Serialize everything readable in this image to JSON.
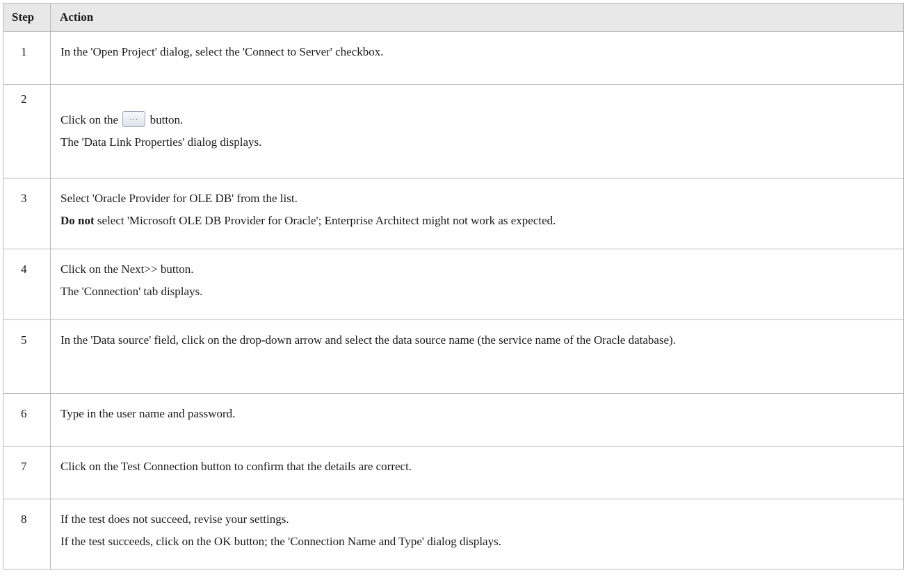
{
  "headers": {
    "step": "Step",
    "action": "Action"
  },
  "rows": [
    {
      "step": "1",
      "lines": [
        "In the 'Open Project' dialog, select the 'Connect to Server' checkbox."
      ]
    },
    {
      "step": "2",
      "click_before": "Click on the",
      "button_icon": "ellipsis-button-icon",
      "button_glyph": "···",
      "click_after": "button.",
      "line2": "The 'Data Link Properties' dialog displays."
    },
    {
      "step": "3",
      "line1": "Select 'Oracle Provider for OLE DB' from the list.",
      "bold": "Do not",
      "line2_rest": " select 'Microsoft OLE DB Provider for Oracle'; Enterprise Architect might not work as expected."
    },
    {
      "step": "4",
      "lines": [
        "Click on the Next>> button.",
        "The 'Connection' tab displays."
      ]
    },
    {
      "step": "5",
      "lines": [
        "In the 'Data source' field, click on the drop-down arrow and select the data source name (the service name of the Oracle database)."
      ]
    },
    {
      "step": "6",
      "lines": [
        "Type in the user name and password."
      ]
    },
    {
      "step": "7",
      "lines": [
        "Click on the Test Connection button to confirm that the details are correct."
      ]
    },
    {
      "step": "8",
      "lines": [
        "If the test does not succeed, revise your settings.",
        "If the test succeeds, click on the OK button; the 'Connection Name and Type' dialog displays."
      ]
    }
  ]
}
